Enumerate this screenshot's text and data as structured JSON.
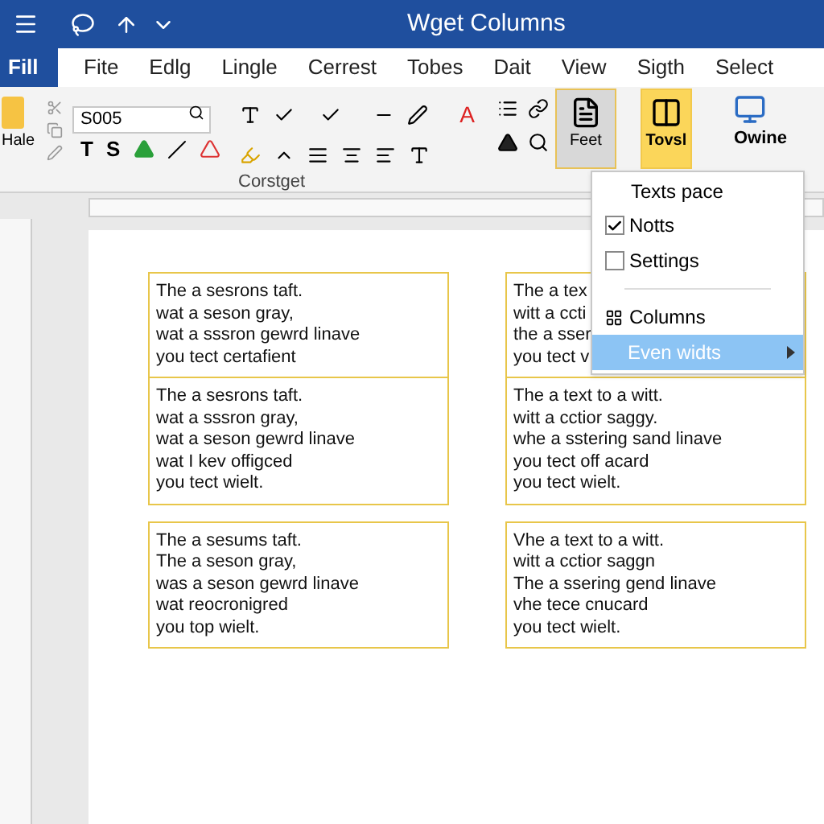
{
  "window": {
    "title": "Wget Columns"
  },
  "menu_tabs": [
    {
      "label": "Fill",
      "selected": true
    },
    {
      "label": "Fite",
      "selected": false
    },
    {
      "label": "Edlg",
      "selected": false
    },
    {
      "label": "Lingle",
      "selected": false
    },
    {
      "label": "Cerrest",
      "selected": false
    },
    {
      "label": "Tobes",
      "selected": false
    },
    {
      "label": "Dait",
      "selected": false
    },
    {
      "label": "View",
      "selected": false
    },
    {
      "label": "Sigth",
      "selected": false
    },
    {
      "label": "Select",
      "selected": false
    }
  ],
  "ribbon": {
    "paste_label": "Hale",
    "font_field": {
      "value": "S005"
    },
    "format_letters": [
      "T",
      "S"
    ],
    "font_color_letter": "A",
    "group_label": "Corstget",
    "big_buttons": [
      {
        "label": "Feet",
        "kind": "open"
      },
      {
        "label": "Tovsl",
        "kind": "accent"
      }
    ],
    "right_label": "Owine"
  },
  "columns": [
    {
      "boxes": [
        {
          "lines": [
            "The a sesrons taft.",
            "wat a seson gray,",
            "wat a sssron gewrd linave",
            "you tect certafient"
          ]
        },
        {
          "lines": [
            "The a sesrons taft.",
            "wat a sssron gray,",
            "wat a seson gewrd linave",
            "wat I kev offigced",
            "you tect wielt."
          ]
        },
        {
          "lines": [
            "The a sesums taft.",
            "The a seson gray,",
            "was a seson gewrd linave",
            "wat reocronigred",
            "you top wielt."
          ]
        }
      ]
    },
    {
      "boxes": [
        {
          "lines": [
            "The a tex",
            "witt a ccti",
            "the a sser",
            "you tect v"
          ]
        },
        {
          "lines": [
            "The a text to a witt.",
            "witt a cctior saggy.",
            "whe a sstering sand linave",
            "you tect off acard",
            "you tect wielt."
          ]
        },
        {
          "lines": [
            "Vhe a text to a witt.",
            "witt a cctior saggn",
            "The a ssering gend linave",
            "vhe tece cnucard",
            "you tect wielt."
          ]
        }
      ]
    }
  ],
  "dropdown": {
    "items": [
      {
        "kind": "heading",
        "label": "Texts pace"
      },
      {
        "kind": "check",
        "label": "Notts",
        "checked": true
      },
      {
        "kind": "check",
        "label": "Settings",
        "checked": false
      },
      {
        "kind": "icon",
        "label": "Columns"
      },
      {
        "kind": "submenu",
        "label": "Even widts",
        "selected": true
      }
    ]
  }
}
